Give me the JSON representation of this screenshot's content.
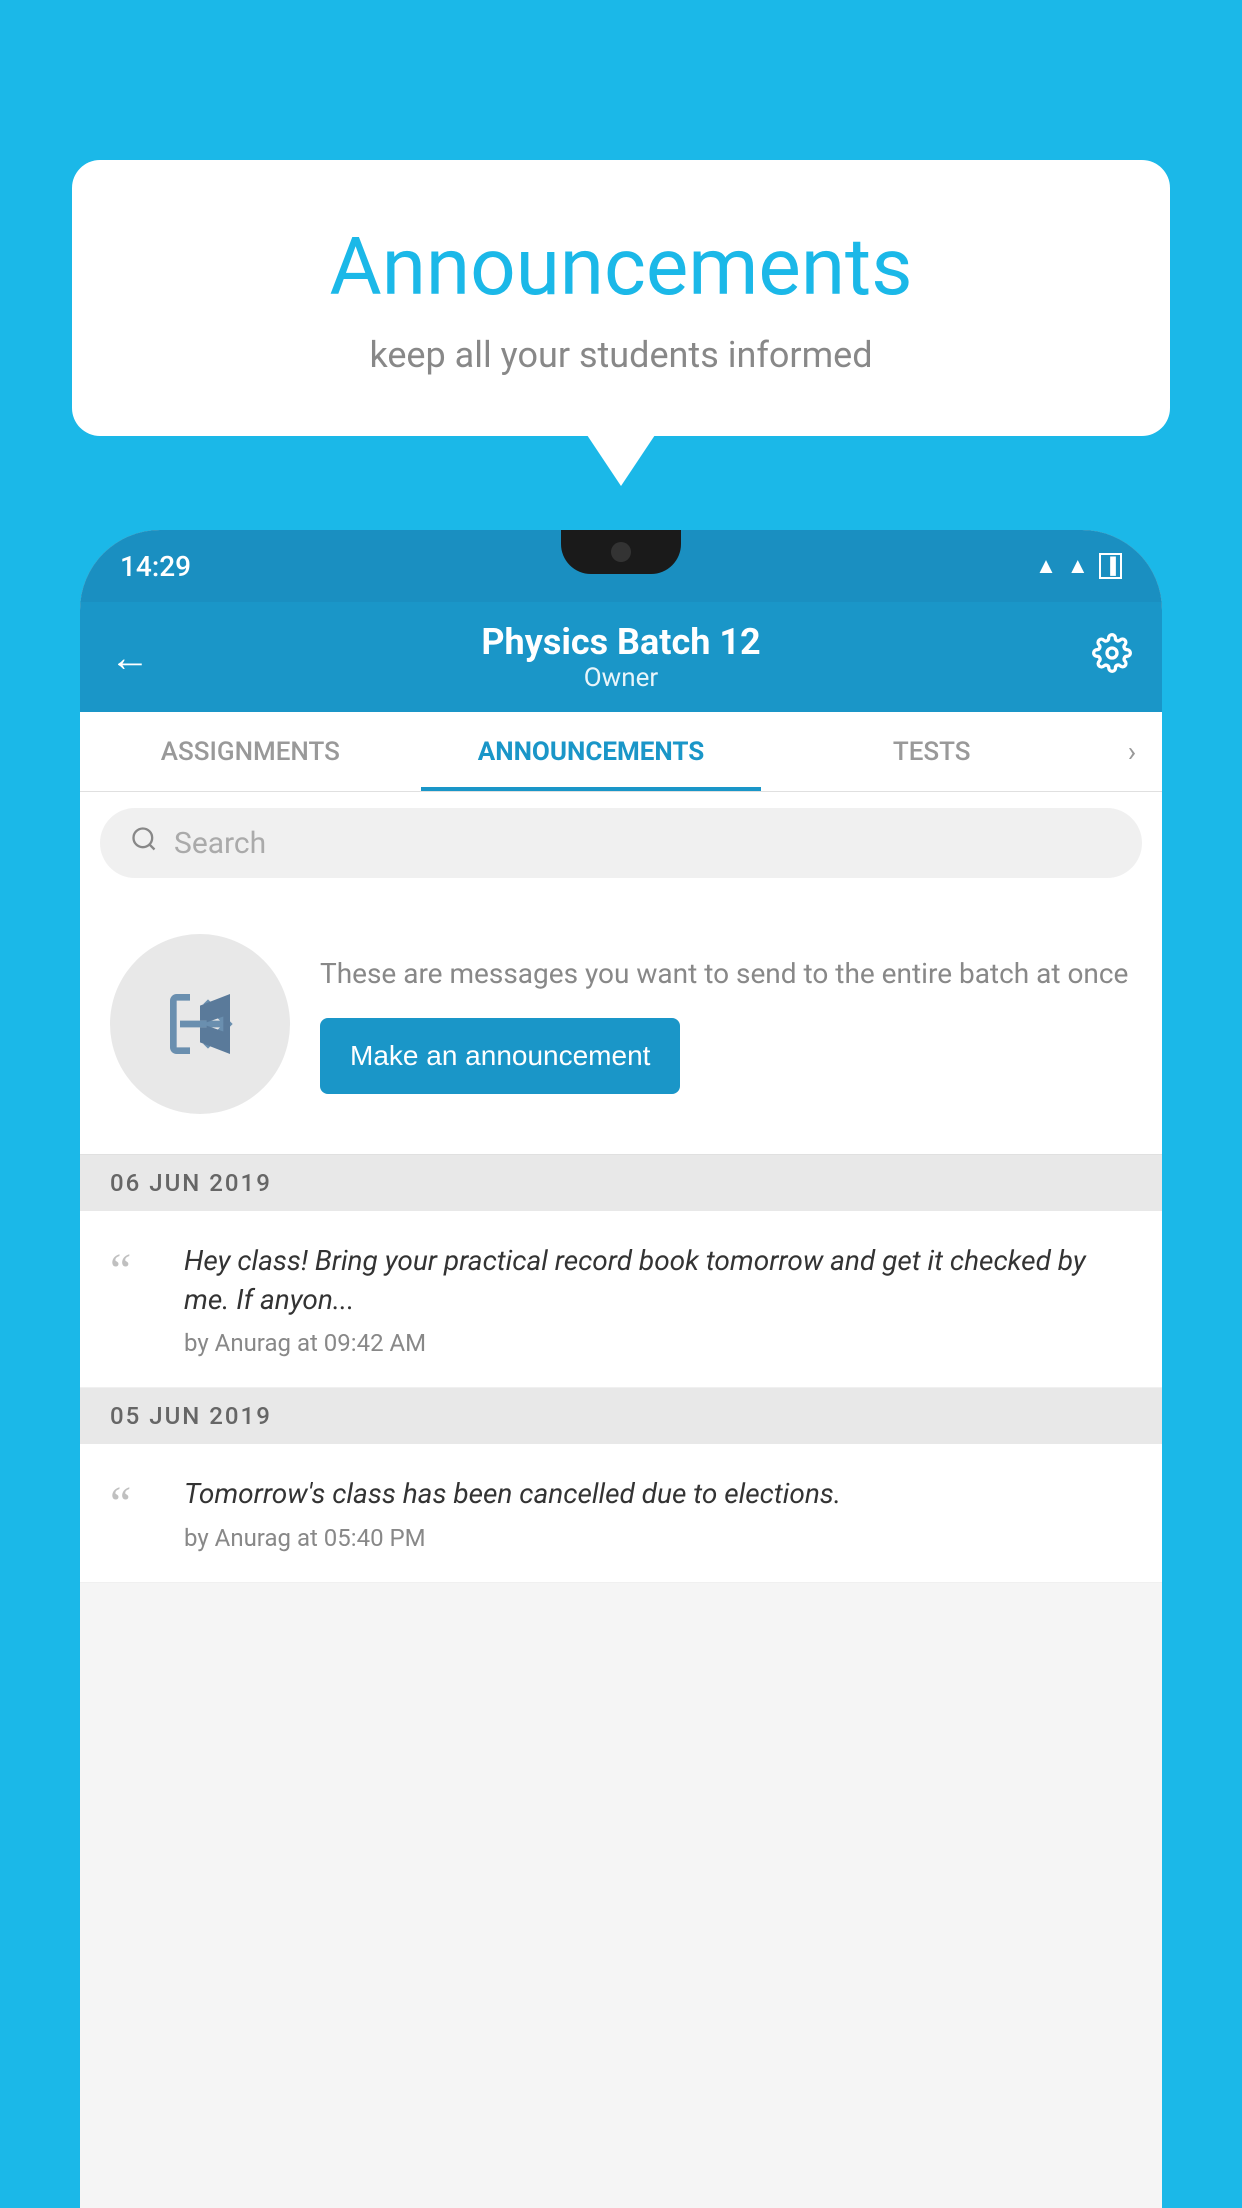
{
  "bubble": {
    "title": "Announcements",
    "subtitle": "keep all your students informed"
  },
  "statusBar": {
    "time": "14:29"
  },
  "appBar": {
    "title": "Physics Batch 12",
    "subtitle": "Owner"
  },
  "tabs": [
    {
      "label": "ASSIGNMENTS",
      "active": false
    },
    {
      "label": "ANNOUNCEMENTS",
      "active": true
    },
    {
      "label": "TESTS",
      "active": false
    }
  ],
  "search": {
    "placeholder": "Search"
  },
  "promo": {
    "text": "These are messages you want to send to the entire batch at once",
    "buttonLabel": "Make an announcement"
  },
  "announcements": [
    {
      "date": "06  JUN  2019",
      "text": "Hey class! Bring your practical record book tomorrow and get it checked by me. If anyon...",
      "meta": "by Anurag at 09:42 AM"
    },
    {
      "date": "05  JUN  2019",
      "text": "Tomorrow's class has been cancelled due to elections.",
      "meta": "by Anurag at 05:40 PM"
    }
  ],
  "colors": {
    "primary": "#1a96c8",
    "background": "#1bb8e8",
    "white": "#ffffff"
  }
}
